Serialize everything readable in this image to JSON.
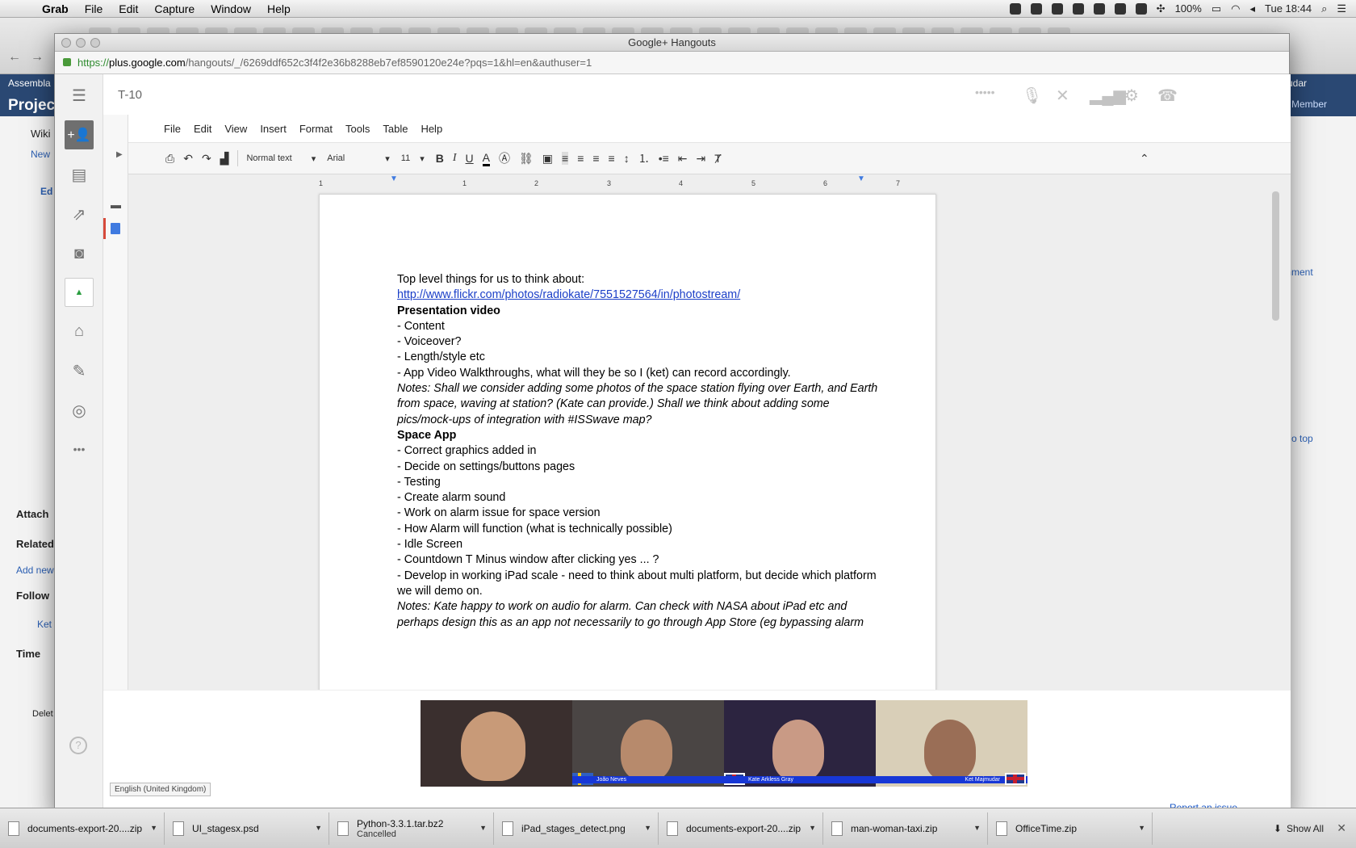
{
  "menubar": {
    "app": "Grab",
    "items": [
      "File",
      "Edit",
      "Capture",
      "Window",
      "Help"
    ],
    "battery": "100%",
    "clock": "Tue 18:44"
  },
  "background_page": {
    "top_link": "Assembla",
    "project_title": "Projec",
    "wiki_tab": "Wiki",
    "new_link": "New",
    "edit_tab": "Ed",
    "sections": [
      "Attach",
      "Related",
      "Follow",
      "Time"
    ],
    "add_new": "Add new",
    "follower": "Ket",
    "delete": "Delet",
    "right_top": "udar",
    "member": "Member",
    "comment": "mment",
    "to_top": "o top"
  },
  "hangouts_window": {
    "title": "Google+ Hangouts",
    "url_scheme": "https://",
    "url_domain": "plus.google.com",
    "url_path": "/hangouts/_/6269ddf652c3f4f2e36b8288eb7ef8590120e24e?pqs=1&hl=en&authuser=1",
    "hangout_name": "T-10"
  },
  "docs": {
    "menu": [
      "File",
      "Edit",
      "View",
      "Insert",
      "Format",
      "Tools",
      "Table",
      "Help"
    ],
    "style_select": "Normal text",
    "font_select": "Arial",
    "size_select": "11",
    "ruler_numbers": [
      "1",
      "1",
      "2",
      "3",
      "4",
      "5",
      "6",
      "7"
    ],
    "lines": [
      {
        "text": "Top level things for us to think about:",
        "style": ""
      },
      {
        "text": "http://www.flickr.com/photos/radiokate/7551527564/in/photostream/",
        "style": "lnk"
      },
      {
        "text": " ",
        "style": ""
      },
      {
        "text": "Presentation video",
        "style": "b"
      },
      {
        "text": "-   Content",
        "style": ""
      },
      {
        "text": "-   Voiceover?",
        "style": ""
      },
      {
        "text": "-   Length/style etc",
        "style": ""
      },
      {
        "text": "-   App Video Walkthroughs, what will they be so I (ket)  can record accordingly.",
        "style": ""
      },
      {
        "text": "Notes: Shall we consider adding some photos of the space station flying over Earth, and Earth",
        "style": "i"
      },
      {
        "text": "from space, waving at station? (Kate can provide.) Shall we think about adding some",
        "style": "i"
      },
      {
        "text": "pics/mock-ups of integration with #ISSwave map?",
        "style": "i"
      },
      {
        "text": " ",
        "style": ""
      },
      {
        "text": "Space App",
        "style": "b"
      },
      {
        "text": "-   Correct graphics added in",
        "style": ""
      },
      {
        "text": "-   Decide on settings/buttons pages",
        "style": ""
      },
      {
        "text": "-   Testing",
        "style": ""
      },
      {
        "text": "-   Create alarm sound",
        "style": ""
      },
      {
        "text": "-   Work on alarm issue for space version",
        "style": ""
      },
      {
        "text": "-    How Alarm will function (what is technically possible)",
        "style": ""
      },
      {
        "text": "-    Idle Screen",
        "style": ""
      },
      {
        "text": "-   Countdown T Minus window after clicking yes ... ?",
        "style": ""
      },
      {
        "text": "-   Develop in working iPad scale - need to think about multi platform, but decide which platform",
        "style": ""
      },
      {
        "text": "we will demo on.",
        "style": ""
      },
      {
        "text": "Notes: Kate happy to work on audio for alarm. Can check with NASA about iPad etc and",
        "style": "i"
      },
      {
        "text": "perhaps design this as an app not necessarily to go through App Store (eg bypassing alarm",
        "style": "i"
      }
    ]
  },
  "video_strip": {
    "participants": [
      {
        "label": "",
        "flag": ""
      },
      {
        "label": "João Neves",
        "flag": "se"
      },
      {
        "label": "Kate Arkless Gray",
        "flag": "uk"
      },
      {
        "label": "Ket Majmudar",
        "flag": "uk"
      }
    ]
  },
  "language": "English (United Kingdom)",
  "report_issue": "Report an issue",
  "downloads": [
    {
      "name": "documents-export-20....zip",
      "sub": ""
    },
    {
      "name": "UI_stagesx.psd",
      "sub": ""
    },
    {
      "name": "Python-3.3.1.tar.bz2",
      "sub": "Cancelled"
    },
    {
      "name": "iPad_stages_detect.png",
      "sub": ""
    },
    {
      "name": "documents-export-20....zip",
      "sub": ""
    },
    {
      "name": "man-woman-taxi.zip",
      "sub": ""
    },
    {
      "name": "OfficeTime.zip",
      "sub": ""
    }
  ],
  "show_all": "Show All"
}
